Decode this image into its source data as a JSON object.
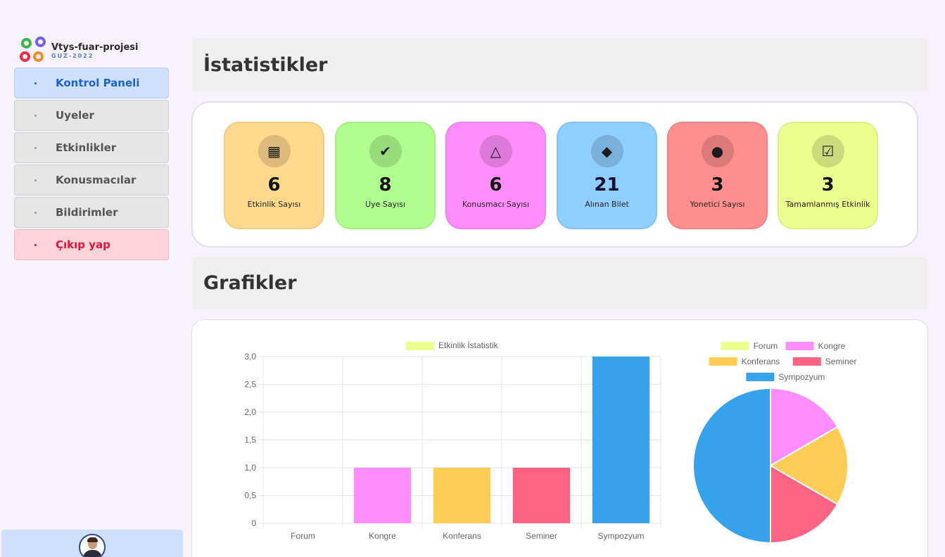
{
  "app": {
    "title": "Vtys-fuar-projesi",
    "subtitle": "GUZ-2022"
  },
  "sidebar": {
    "items": [
      {
        "label": "Kontrol Paneli"
      },
      {
        "label": "Uyeler"
      },
      {
        "label": "Etkinlikler"
      },
      {
        "label": "Konusmacılar"
      },
      {
        "label": "Bildirimler"
      },
      {
        "label": "Çıkıp yap"
      }
    ]
  },
  "sections": {
    "stats_title": "İstatistikler",
    "charts_title": "Grafikler"
  },
  "stats": [
    {
      "value": "6",
      "label": "Etkinlik Sayısı",
      "icon": "presentation-board-icon",
      "bg": "#ffd98e",
      "color": "#111111"
    },
    {
      "value": "8",
      "label": "Uye Sayısı",
      "icon": "user-check-icon",
      "bg": "#b0ff8e",
      "color": "#111111"
    },
    {
      "value": "6",
      "label": "Konusmacı Sayısı",
      "icon": "speaker-podium-icon",
      "bg": "#ff8efc",
      "color": "#111111"
    },
    {
      "value": "21",
      "label": "Alınan Bilet",
      "icon": "ticket-icon",
      "bg": "#8ecfff",
      "color": "#111133"
    },
    {
      "value": "3",
      "label": "Yonetici Sayısı",
      "icon": "user-lock-icon",
      "bg": "#ff8e8e",
      "color": "#111111"
    },
    {
      "value": "3",
      "label": "Tamamlanmış Etkinlik",
      "icon": "calendar-check-icon",
      "bg": "#ebff8e",
      "color": "#111111"
    }
  ],
  "chart_data": [
    {
      "type": "bar",
      "legend": [
        "Etkinlik İstatistik"
      ],
      "legend_position": "top",
      "categories": [
        "Forum",
        "Kongre",
        "Konferans",
        "Seminer",
        "Sympozyum"
      ],
      "values": [
        0,
        1,
        1,
        1,
        3
      ],
      "colors": [
        "#ebff8e",
        "#ff8efc",
        "#ffcd56",
        "#ff6384",
        "#36a2eb"
      ],
      "series": [
        {
          "name": "Etkinlik İstatistik",
          "values": [
            0,
            1,
            1,
            1,
            3
          ]
        }
      ],
      "ylim": [
        0,
        3
      ],
      "yticks": [
        "3,0",
        "2,5",
        "2,0",
        "1,5",
        "1,0",
        "0,5",
        "0"
      ],
      "grid": true
    },
    {
      "type": "pie",
      "legend_position": "top",
      "categories": [
        "Forum",
        "Kongre",
        "Konferans",
        "Seminer",
        "Sympozyum"
      ],
      "values": [
        0,
        1,
        1,
        1,
        3
      ],
      "colors": [
        "#ebff8e",
        "#ff8efc",
        "#ffcd56",
        "#ff6384",
        "#36a2eb"
      ]
    }
  ]
}
